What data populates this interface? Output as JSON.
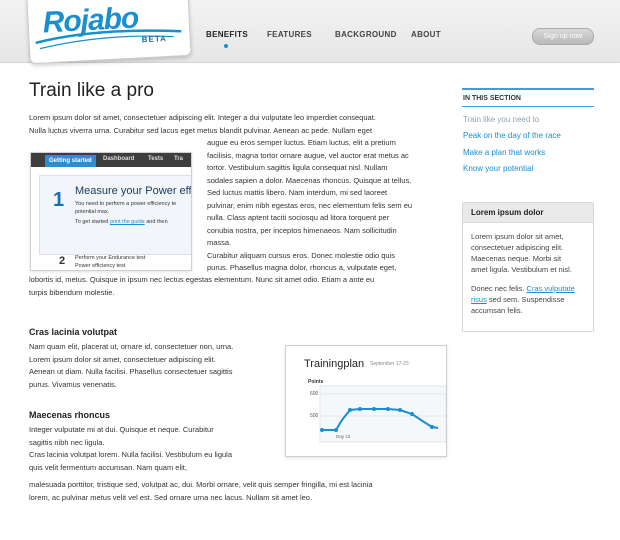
{
  "header": {
    "logo_text": "Rojabo",
    "beta_label": "BETA",
    "nav": [
      {
        "label": "BENEFITS",
        "active": true
      },
      {
        "label": "FEATURES",
        "active": false
      },
      {
        "label": "BACKGROUND",
        "active": false
      },
      {
        "label": "ABOUT",
        "active": false
      }
    ],
    "signup_label": "Sign up now",
    "accent_color": "#1a8fd0"
  },
  "main": {
    "title": "Train like a pro",
    "intro_line1": "Lorem ipsum dolor sit amet, consectetuer adipiscing elit. Integer a dui vulputate leo imperdiet consequat.",
    "intro_line2": "Nulla luctus viverra urna. Curabitur sed lacus eget metus blandit pulvinar. Aenean ac pede. Nullam eget",
    "wrap_lines": [
      "augue eu eros semper luctus. Etiam luctus, elit a pretium",
      "facilisis, magna tortor ornare augue, vel auctor erat metus ac",
      "tortor. Vestibulum sagittis ligula consequat nisl. Nullam",
      "sodales sapien a dolor. Maecenas rhoncus. Quisque at tellus.",
      "Sed luctus mattis libero. Nam interdum, mi sed laoreet",
      "pulvinar, enim nibh egestas eros, nec elementum felis sem eu",
      "nulla. Class aptent taciti sociosqu ad litora torquent per",
      "conubia nostra, per inceptos himenaeos. Nam sollicitudin",
      "massa.",
      "Curabitur aliquam cursus eros. Donec molestie odio quis",
      "purus. Phasellus magna dolor, rhoncus a, vulputate eget,"
    ],
    "tail_line1": "lobortis id, metus. Quisque in ipsum nec lectus egestas elementum. Nunc sit amet odio. Etiam a ante eu",
    "tail_line2": "turpis bibendum molestie.",
    "screenshot1": {
      "tab1": "Getting started",
      "tab2": "Dashboard",
      "tab3": "Tests",
      "tab4": "Tra",
      "step_num": "1",
      "step_title": "Measure your Power effi",
      "step_line1": "You need to perform a power efficiency te",
      "step_line2": "potential max.",
      "step_line3_pre": "To get started ",
      "step_line3_link": "print the guide",
      "step_line3_post": " and then",
      "step2_num": "2",
      "step2_line1": "Perform your Endurance test",
      "step2_line2": "Power efficiency test"
    },
    "section2": {
      "title": "Cras lacinia volutpat",
      "lines": [
        "Nam quam elit, placerat ut, ornare id, consectetuer non, urna.",
        "Lorem ipsum dolor sit amet, consectetuer adipiscing elit.",
        "Aenean ut diam. Nulla facilisi. Phasellus consectetuer sagittis",
        "purus. Vivamus venenatis."
      ]
    },
    "section3": {
      "title": "Maecenas rhoncus",
      "lines": [
        "Integer vulputate mi at dui. Quisque et neque. Curabitur",
        "sagittis nibh nec ligula.",
        "Cras lacinia volutpat lorem. Nulla facilisi. Vestibulum eu ligula",
        "quis velit fermentum accumsan. Nam quam elit,"
      ],
      "tail1": " malesuada porttitor, tristique sed, volutpat ac, dui. Morbi ornare, velit quis semper fringilla, mi est lacinia",
      "tail2": "lorem, ac pulvinar metus velit vel est. Sed ornare urna nec lacus. Nullam sit amet leo."
    },
    "screenshot2": {
      "title": "Trainingplan",
      "subtitle": "September 17-23",
      "y_label": "Points",
      "tick_600": "600",
      "tick_500": "500",
      "x_label": "Day 13"
    }
  },
  "sidebar": {
    "heading": "IN THIS SECTION",
    "items": [
      {
        "label": "Train like you need to",
        "color": "#8aa3b8"
      },
      {
        "label": "Peak on the day of the race",
        "color": "#1a8fd0"
      },
      {
        "label": "Make a plan that works",
        "color": "#1a8fd0"
      },
      {
        "label": "Know your potential",
        "color": "#1a8fd0"
      }
    ],
    "box": {
      "title": "Lorem ipsum dolor",
      "lines": [
        "Lorem ipsum dolor sit amet,",
        "consectetuer adipiscing elit.",
        "Maecenas neque. Morbi sit",
        "amet ligula. Vestibulum et nisl."
      ],
      "p2_pre": "Donec nec felis. ",
      "p2_link1": "Cras vulputate",
      "p2_link2": "risus",
      "p2_post1": " sed sem. Suspendisse",
      "p2_post2": "accumsan felis."
    }
  }
}
